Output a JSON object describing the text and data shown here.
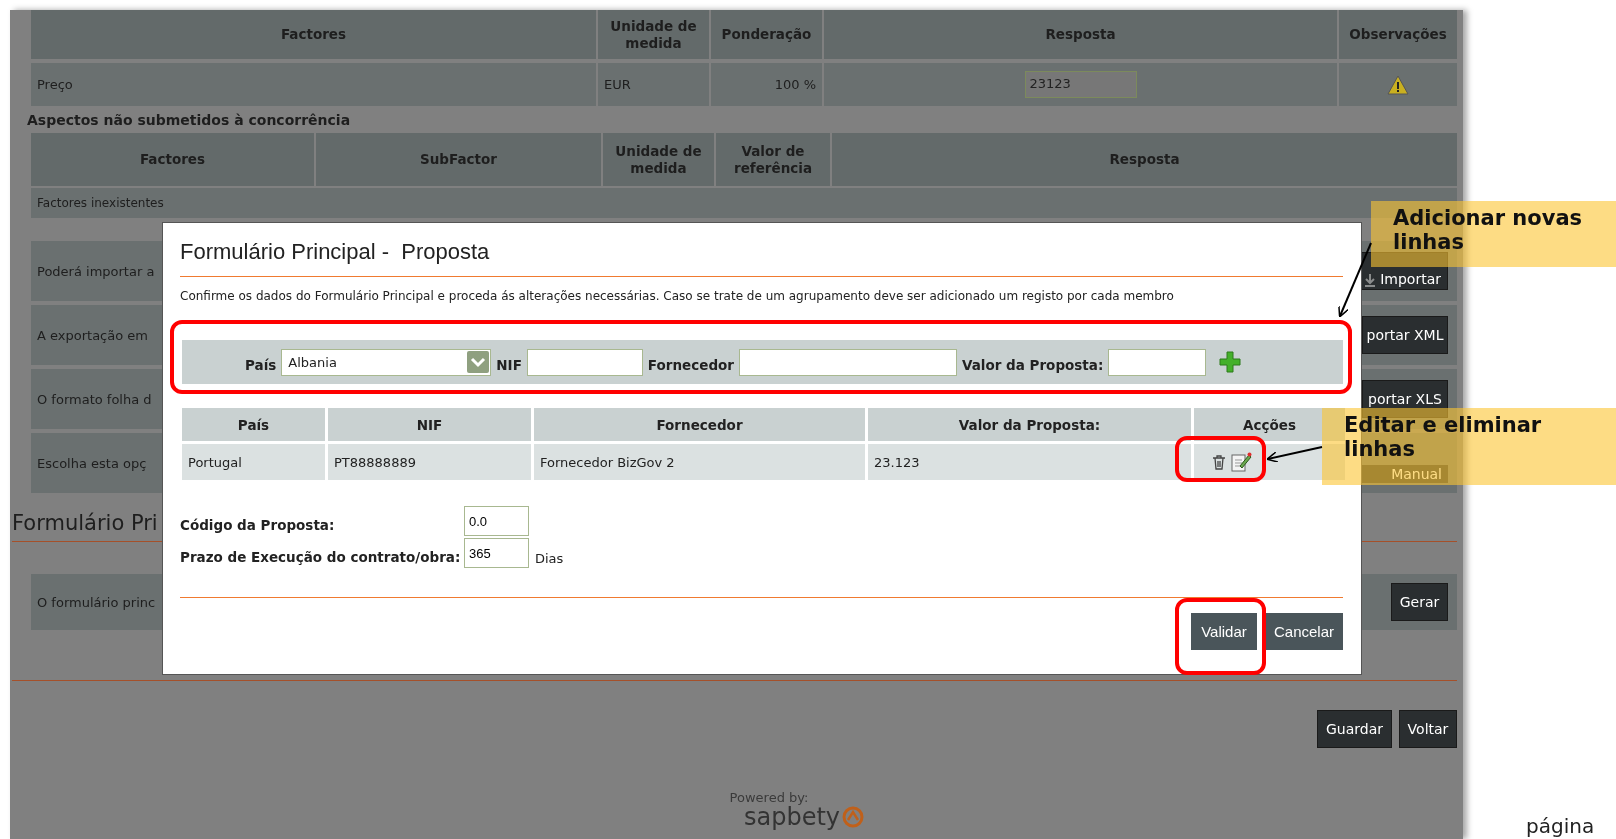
{
  "page": {
    "factors_table": {
      "columns": [
        "Factores",
        "Unidade de medida",
        "Ponderação",
        "Resposta",
        "Observações"
      ],
      "rows": [
        {
          "factor": "Preço",
          "unit": "EUR",
          "weight": "100 %",
          "answer": "23123"
        }
      ]
    },
    "non_competition": {
      "title": "Aspectos não submetidos à concorrência",
      "columns": [
        "Factores",
        "SubFactor",
        "Unidade de medida",
        "Valor de referência",
        "Resposta"
      ],
      "empty_message": "Factores inexistentes"
    },
    "option_rows": [
      {
        "text": "Poderá importar a",
        "button": "Importar",
        "kind": "import"
      },
      {
        "text": "A exportação em",
        "button": "portar XML",
        "kind": "plain"
      },
      {
        "text": "O formato folha d",
        "button": "portar XLS",
        "kind": "plain"
      },
      {
        "text": "Escolha esta opç",
        "button": "Manual",
        "kind": "plain"
      }
    ],
    "section": {
      "title": "Formulário Pri",
      "text": "O formulário princ",
      "button": "Gerar"
    },
    "footer_buttons": [
      "Guardar",
      "Voltar"
    ],
    "powered_by": "Powered by:",
    "logo": "sapbety"
  },
  "modal": {
    "title": "Formulário Principal -  Proposta",
    "instructions": "Confirme os dados do Formulário Principal e proceda ás alterações necessárias. Caso se trate de um agrupamento deve ser adicionado um registo por cada membro",
    "add_form": [
      {
        "label": "País",
        "kind": "select",
        "value": "Albania"
      },
      {
        "label": "NIF",
        "kind": "text"
      },
      {
        "label": "Fornecedor",
        "kind": "text"
      },
      {
        "label": "Valor da Proposta:",
        "kind": "text"
      }
    ],
    "table": {
      "columns": [
        "País",
        "NIF",
        "Fornecedor",
        "Valor da Proposta:",
        "Acções"
      ],
      "rows": [
        {
          "cells": [
            "Portugal",
            "PT88888889",
            "Fornecedor BizGov 2",
            "23.123"
          ]
        }
      ]
    },
    "fields": [
      {
        "label": "Código da Proposta:",
        "value": "0.0"
      },
      {
        "label": "Prazo de Execução do contrato/obra:",
        "value": "365",
        "unit": "Dias"
      }
    ],
    "buttons": [
      "Validar",
      "Cancelar"
    ]
  },
  "callouts": [
    {
      "text": "Adicionar novas linhas"
    },
    {
      "text": "Editar  e eliminar linhas"
    }
  ],
  "page_footer": "página"
}
